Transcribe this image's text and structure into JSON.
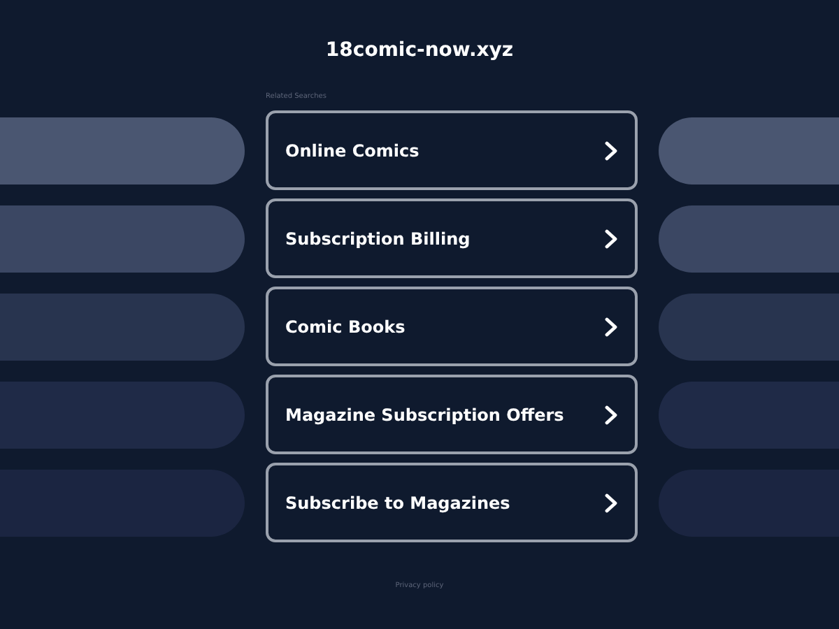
{
  "domain": "18comic-now.xyz",
  "related_label": "Related Searches",
  "links": [
    {
      "label": "Online Comics"
    },
    {
      "label": "Subscription Billing"
    },
    {
      "label": "Comic Books"
    },
    {
      "label": "Magazine Subscription Offers"
    },
    {
      "label": "Subscribe to Magazines"
    }
  ],
  "footer": "Privacy policy"
}
